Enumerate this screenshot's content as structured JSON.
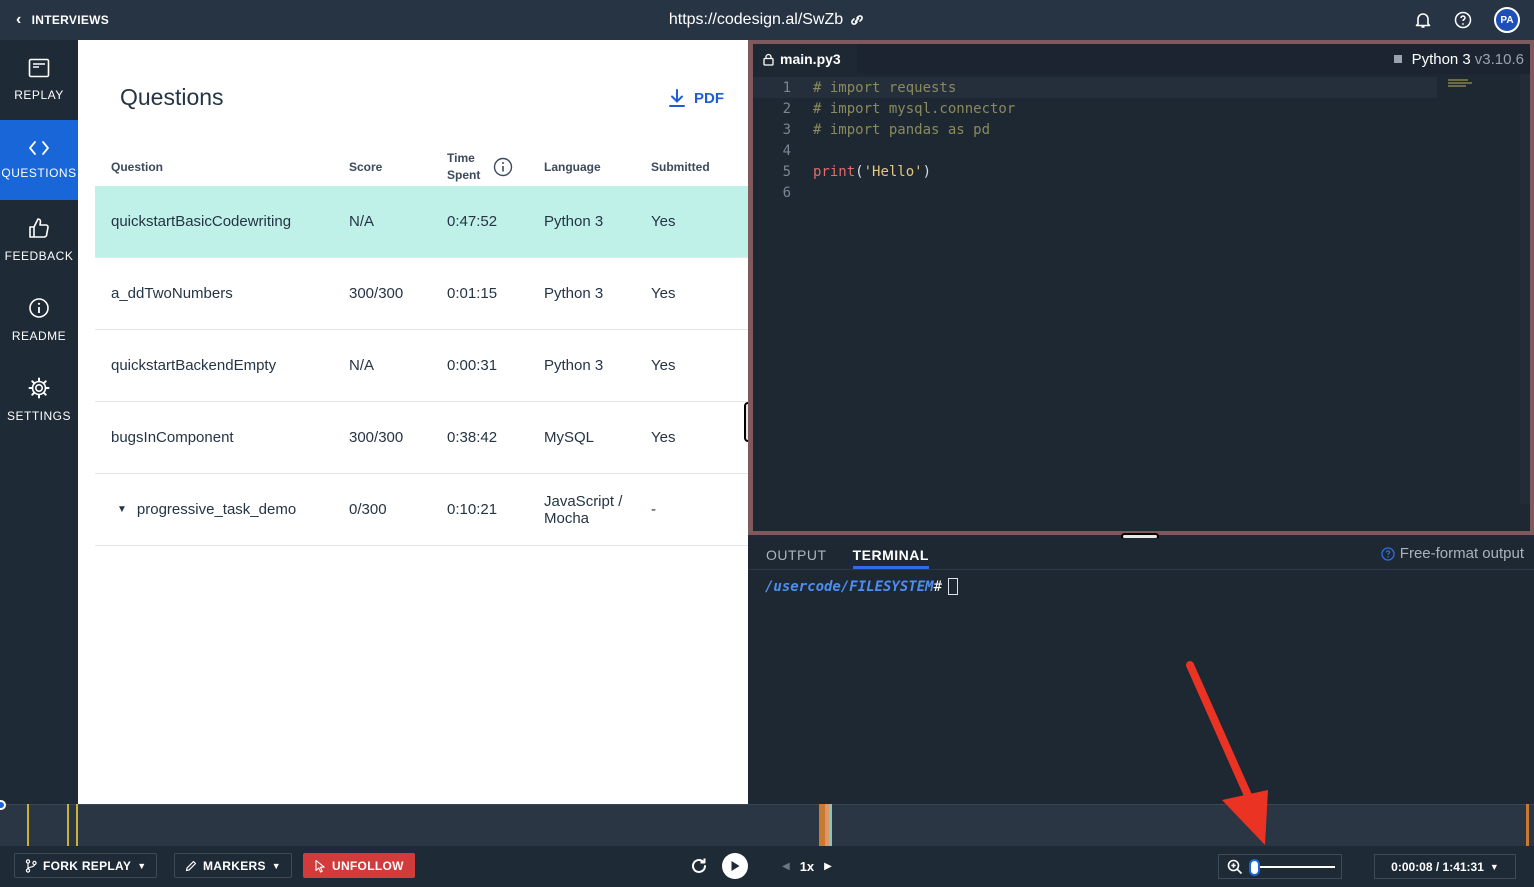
{
  "topbar": {
    "back_label": "INTERVIEWS",
    "url": "https://codesign.al/SwZb",
    "avatar_initials": "PA"
  },
  "sidebar": {
    "items": [
      {
        "label": "REPLAY",
        "icon": "replay-icon",
        "active": false
      },
      {
        "label": "QUESTIONS",
        "icon": "code-icon",
        "active": true
      },
      {
        "label": "FEEDBACK",
        "icon": "thumbs-up-icon",
        "active": false
      },
      {
        "label": "README",
        "icon": "info-icon",
        "active": false
      },
      {
        "label": "SETTINGS",
        "icon": "gear-icon",
        "active": false
      }
    ]
  },
  "questions": {
    "title": "Questions",
    "pdf_label": "PDF",
    "headers": {
      "question": "Question",
      "score": "Score",
      "time_spent": "Time Spent",
      "language": "Language",
      "submitted": "Submitted"
    },
    "rows": [
      {
        "question": "quickstartBasicCodewriting",
        "score": "N/A",
        "time": "0:47:52",
        "language": "Python 3",
        "submitted": "Yes"
      },
      {
        "question": "a_ddTwoNumbers",
        "score": "300/300",
        "time": "0:01:15",
        "language": "Python 3",
        "submitted": "Yes"
      },
      {
        "question": "quickstartBackendEmpty",
        "score": "N/A",
        "time": "0:00:31",
        "language": "Python 3",
        "submitted": "Yes"
      },
      {
        "question": "bugsInComponent",
        "score": "300/300",
        "time": "0:38:42",
        "language": "MySQL",
        "submitted": "Yes"
      },
      {
        "question": "progressive_task_demo",
        "score": "0/300",
        "time": "0:10:21",
        "language": "JavaScript / Mocha",
        "submitted": "-"
      }
    ]
  },
  "editor": {
    "filename": "main.py3",
    "language": "Python 3",
    "version": "v3.10.6",
    "lines": [
      "# import requests",
      "# import mysql.connector",
      "# import pandas as pd",
      "",
      "print('Hello')",
      ""
    ]
  },
  "terminal": {
    "tabs": [
      "OUTPUT",
      "TERMINAL"
    ],
    "active_tab": "TERMINAL",
    "free_format_label": "Free-format output",
    "prompt_path": "/usercode/FILESYSTEM",
    "prompt_symbol": "#"
  },
  "controls": {
    "fork_label": "FORK REPLAY",
    "markers_label": "MARKERS",
    "unfollow_label": "UNFOLLOW",
    "speed": "1x",
    "time": "0:00:08 / 1:41:31",
    "zoom_level": 0.0
  },
  "colors": {
    "accent": "#1866d8",
    "selected_row": "#bff1e8",
    "unfollow": "#d23b3b",
    "annotation_arrow": "#ea3323"
  }
}
